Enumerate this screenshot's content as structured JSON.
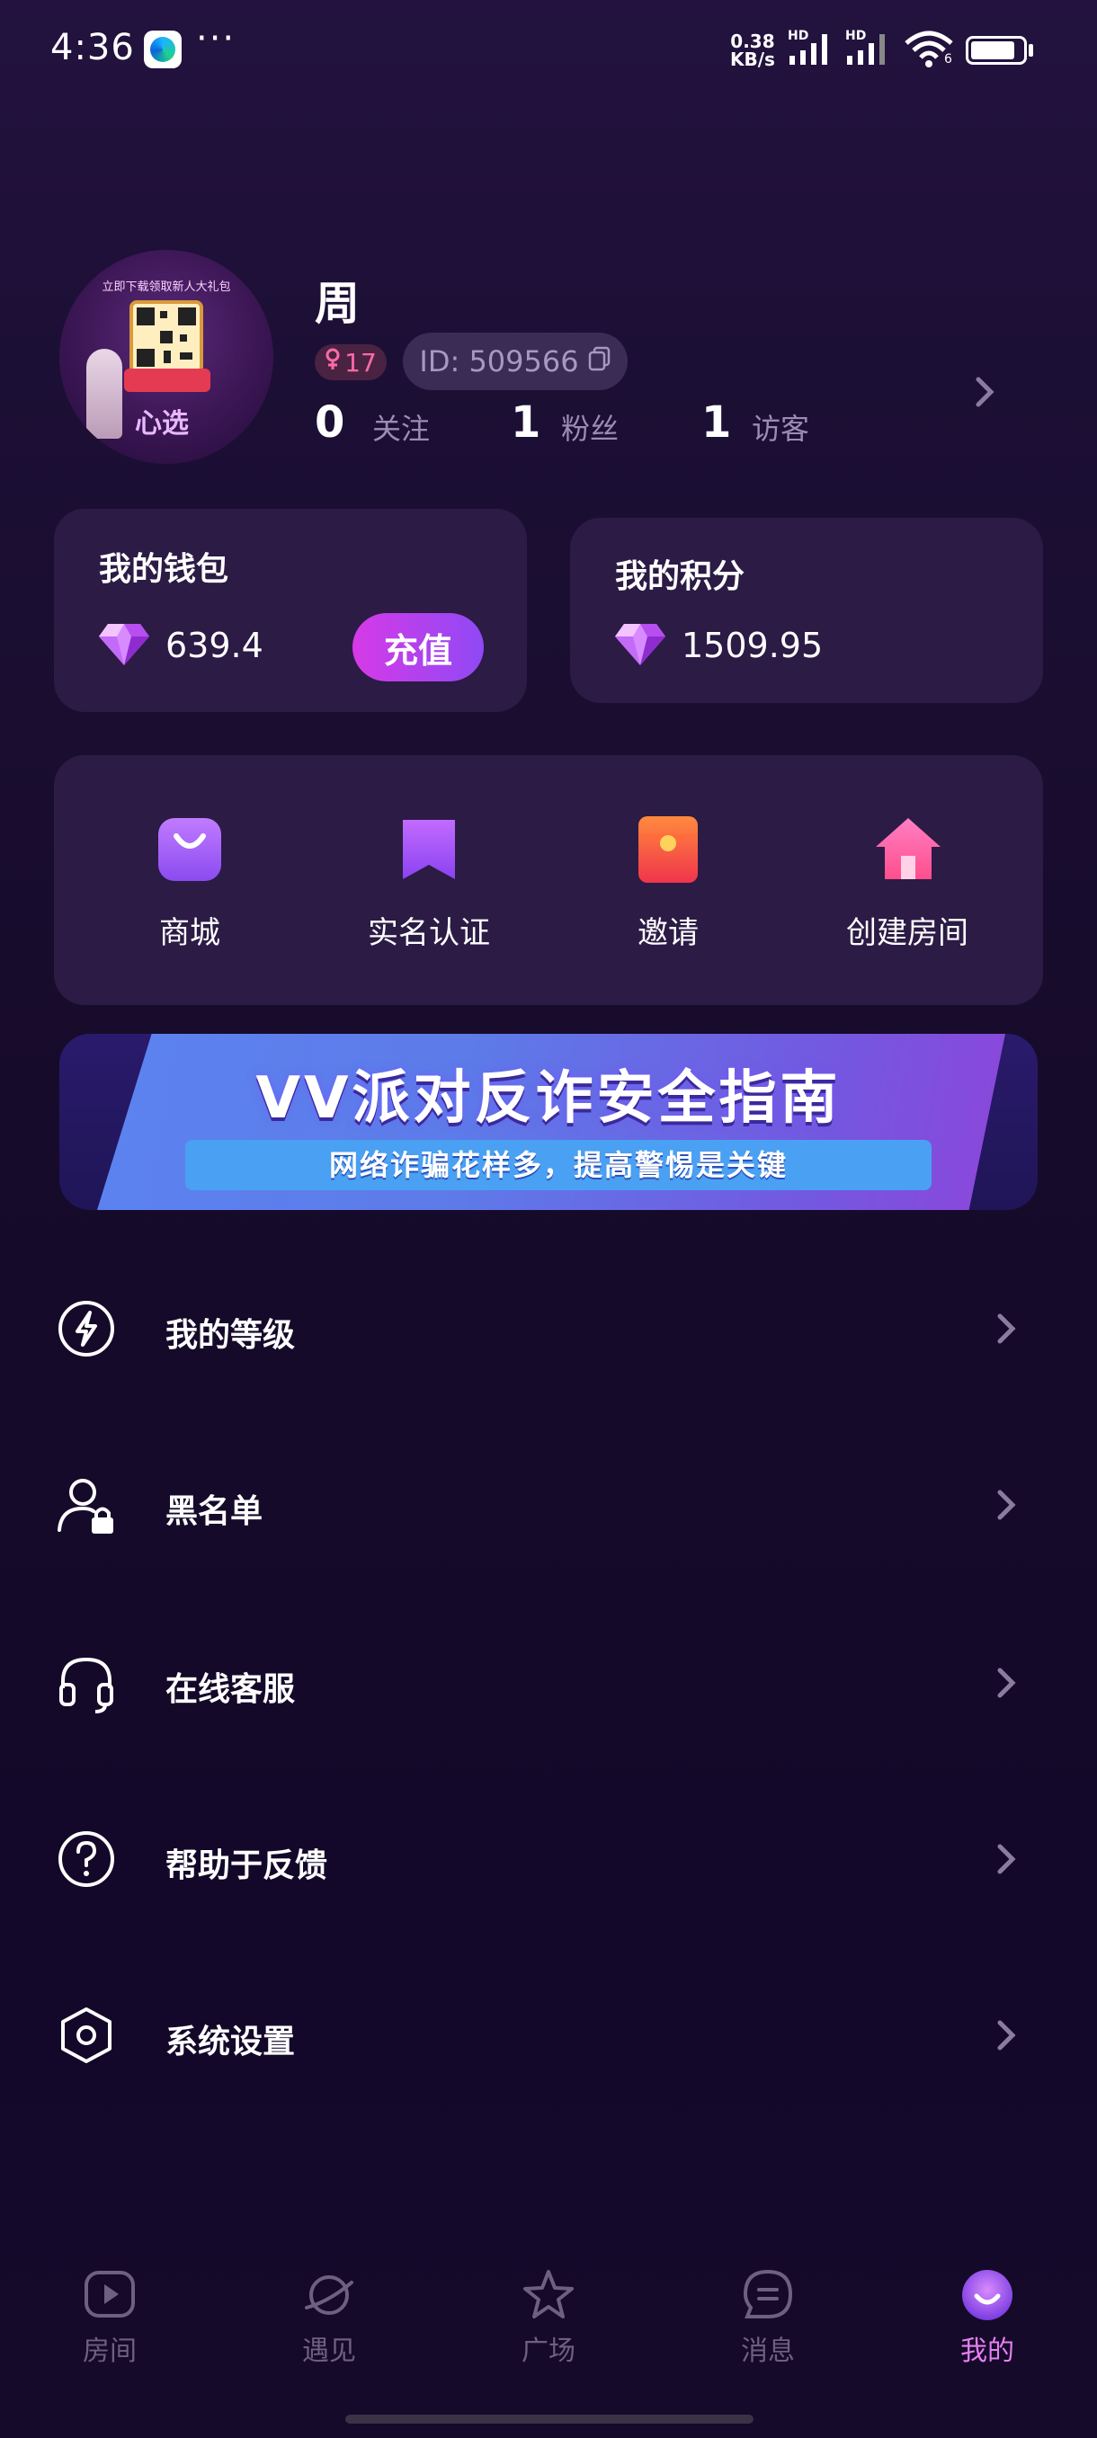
{
  "status_bar": {
    "time": "4:36",
    "more": "···",
    "net_speed_value": "0.38",
    "net_speed_unit": "KB/s",
    "hd1": "HD",
    "hd2": "HD",
    "wifi_num": "6",
    "battery_percent": 85
  },
  "profile": {
    "nickname": "周",
    "level": "17",
    "id_text": "ID: 509566",
    "avatar_text_top": "立即下载领取新人大礼包",
    "avatar_brand": "心选",
    "stats": [
      {
        "value": "0",
        "label": "关注"
      },
      {
        "value": "1",
        "label": "粉丝"
      },
      {
        "value": "1",
        "label": "访客"
      }
    ]
  },
  "wallet": {
    "title": "我的钱包",
    "balance": "639.4",
    "recharge_label": "充值"
  },
  "points": {
    "title": "我的积分",
    "balance": "1509.95"
  },
  "quick_actions": [
    {
      "label": "商城",
      "icon": "shopping-bag-icon"
    },
    {
      "label": "实名认证",
      "icon": "bookmark-icon"
    },
    {
      "label": "邀请",
      "icon": "red-envelope-icon"
    },
    {
      "label": "创建房间",
      "icon": "house-icon"
    }
  ],
  "banner": {
    "title": "VV派对反诈安全指南",
    "subtitle": "网络诈骗花样多，提高警惕是关键"
  },
  "menu": [
    {
      "label": "我的等级",
      "icon": "lightning-icon"
    },
    {
      "label": "黑名单",
      "icon": "user-lock-icon"
    },
    {
      "label": "在线客服",
      "icon": "headset-icon"
    },
    {
      "label": "帮助于反馈",
      "icon": "question-icon"
    },
    {
      "label": "系统设置",
      "icon": "hexagon-settings-icon"
    }
  ],
  "tabs": [
    {
      "label": "房间",
      "icon": "play-icon"
    },
    {
      "label": "遇见",
      "icon": "planet-icon"
    },
    {
      "label": "广场",
      "icon": "star-icon"
    },
    {
      "label": "消息",
      "icon": "message-icon"
    },
    {
      "label": "我的",
      "icon": "profile-icon",
      "active": true
    }
  ],
  "colors": {
    "accent": "#e77ff3",
    "card_bg": "#2b1b45",
    "recharge_start": "#d63ae7",
    "recharge_end": "#8f49f5"
  }
}
